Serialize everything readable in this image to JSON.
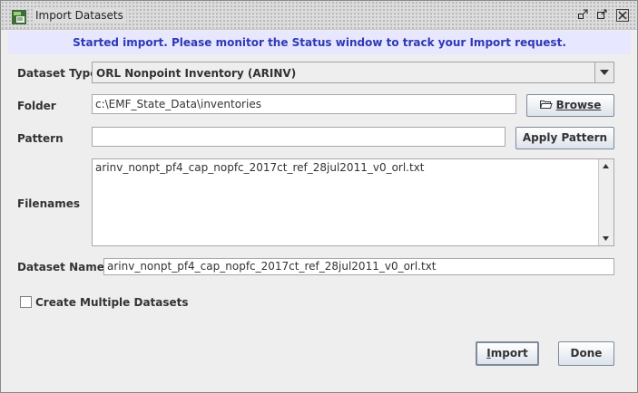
{
  "window": {
    "title": "Import Datasets",
    "icon": "emf-app-icon",
    "controls": {
      "restore_glyph": "⬚",
      "maximize_glyph": "↗",
      "close_glyph": "✕"
    }
  },
  "banner": {
    "message": "Started import. Please monitor the Status window to track your Import request.",
    "color": "#2e39b5",
    "background": "#e7e7ff"
  },
  "form": {
    "dataset_type": {
      "label": "Dataset Type",
      "value": "ORL Nonpoint Inventory (ARINV)"
    },
    "folder": {
      "label": "Folder",
      "value": "c:\\EMF_State_Data\\inventories",
      "browse_label": "Browse"
    },
    "pattern": {
      "label": "Pattern",
      "value": "",
      "apply_label": "Apply Pattern"
    },
    "filenames": {
      "label": "Filenames",
      "value": "arinv_nonpt_pf4_cap_nopfc_2017ct_ref_28jul2011_v0_orl.txt"
    },
    "dataset_names": {
      "label": "Dataset Names",
      "value": "arinv_nonpt_pf4_cap_nopfc_2017ct_ref_28jul2011_v0_orl.txt"
    },
    "multiple": {
      "label": "Create Multiple Datasets",
      "checked": false
    }
  },
  "actions": {
    "import_label": "Import",
    "done_label": "Done"
  }
}
